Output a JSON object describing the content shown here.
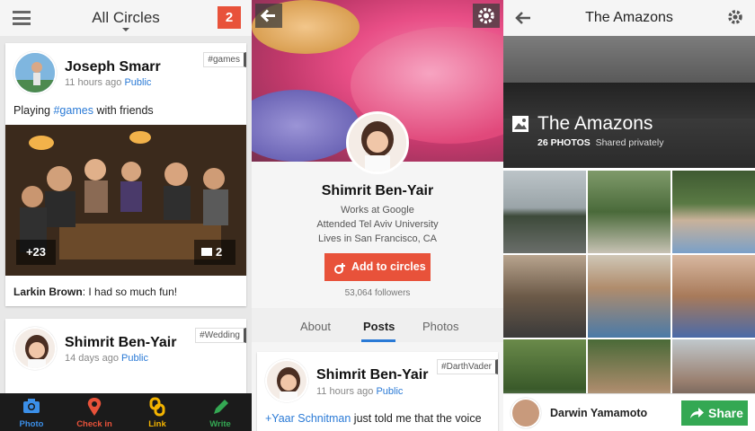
{
  "feed": {
    "title": "All Circles",
    "notification_count": "2",
    "posts": [
      {
        "author": "Joseph Smarr",
        "time": "11 hours ago",
        "visibility": "Public",
        "tag": "#games",
        "text_before": "Playing",
        "hashtag": "#games",
        "text_after": "with friends",
        "photo_extra": "+23",
        "comment_count": "2",
        "comment_author": "Larkin Brown",
        "comment_text": ": I had so much fun!"
      },
      {
        "author": "Shimrit Ben-Yair",
        "time": "14 days ago",
        "visibility": "Public",
        "tag": "#Wedding"
      }
    ],
    "bottom_nav": [
      {
        "label": "Photo",
        "color": "#3b8fe8",
        "icon": "camera-icon"
      },
      {
        "label": "Check in",
        "color": "#e8523a",
        "icon": "location-pin-icon"
      },
      {
        "label": "Link",
        "color": "#f4b400",
        "icon": "link-icon"
      },
      {
        "label": "Write",
        "color": "#34a853",
        "icon": "pencil-icon"
      }
    ]
  },
  "profile": {
    "name": "Shimrit Ben-Yair",
    "work": "Works at Google",
    "education": "Attended Tel Aviv University",
    "location": "Lives in San Francisco, CA",
    "add_button": "Add to circles",
    "followers": "53,064 followers",
    "tabs": [
      "About",
      "Posts",
      "Photos"
    ],
    "active_tab": "Posts",
    "post": {
      "author": "Shimrit Ben-Yair",
      "time": "11 hours ago",
      "visibility": "Public",
      "tag": "#DarthVader",
      "mention": "+Yaar Schnitman",
      "text": "just told me that the voice"
    }
  },
  "album": {
    "title": "The Amazons",
    "hero_title": "The Amazons",
    "photo_count": "26 PHOTOS",
    "sharing": "Shared privately",
    "owner": "Darwin Yamamoto",
    "share_button": "Share"
  },
  "colors": {
    "accent_red": "#e8523a",
    "link_blue": "#2a7ad6",
    "share_green": "#34a853"
  }
}
